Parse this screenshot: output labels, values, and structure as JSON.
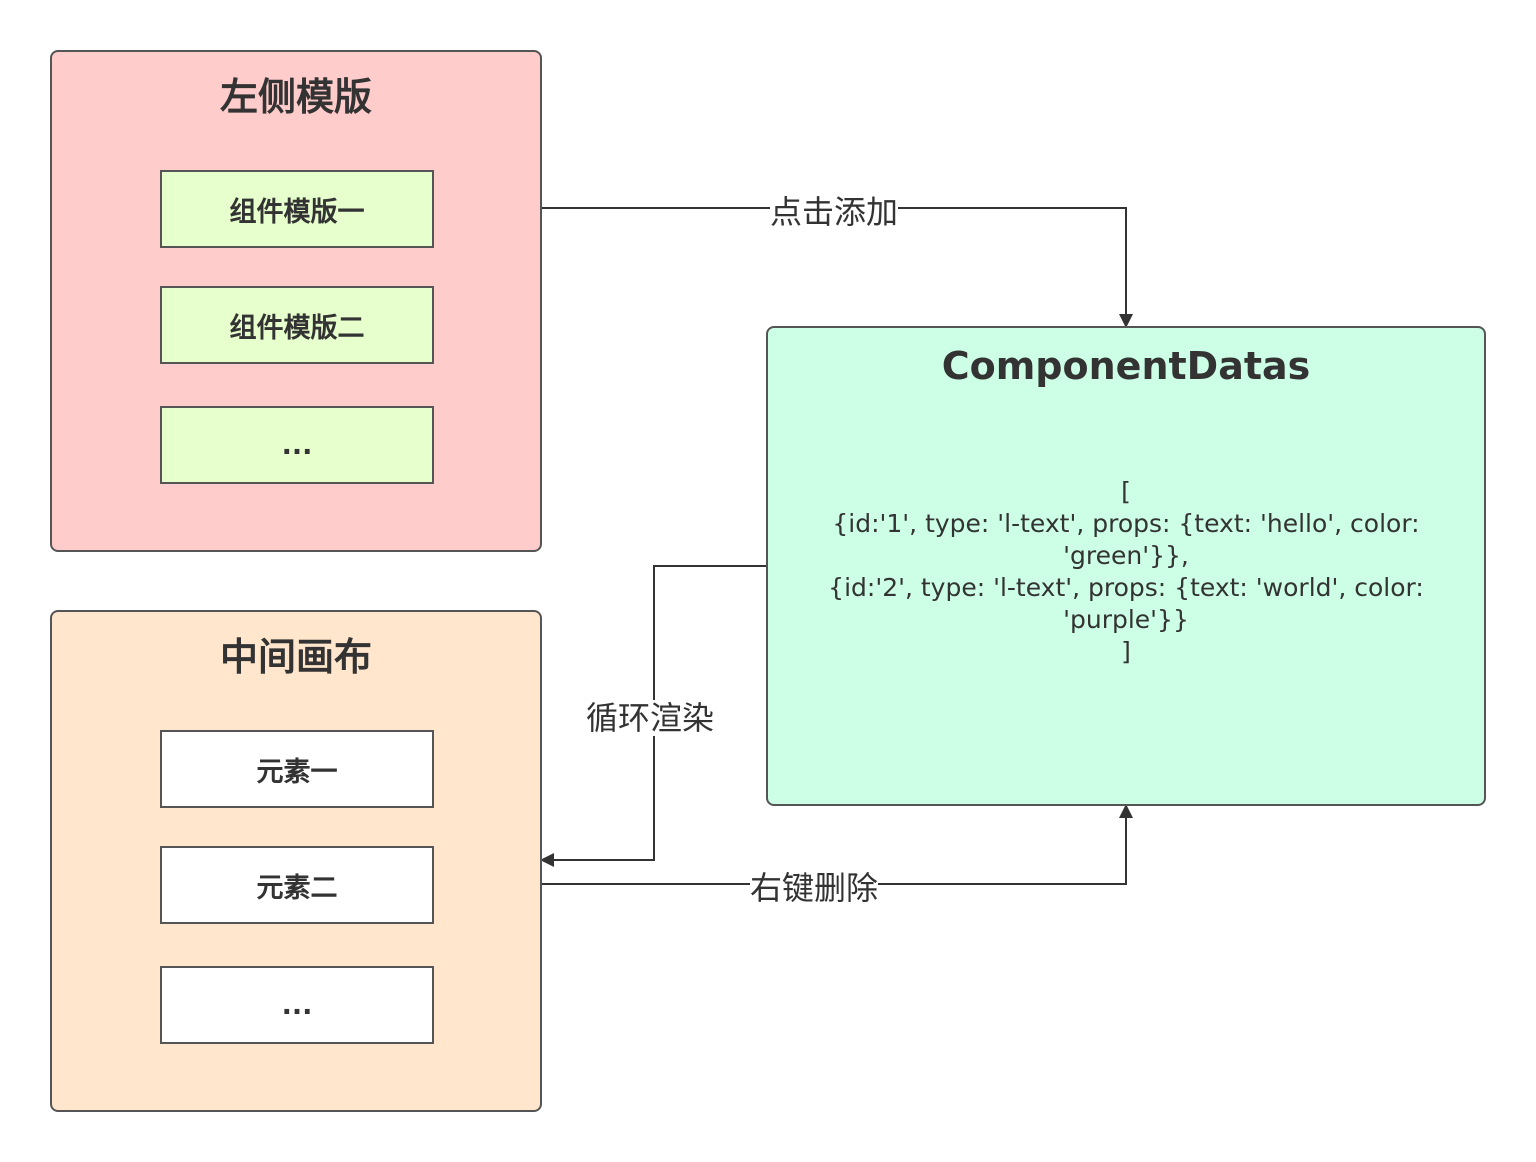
{
  "left_templates": {
    "title": "左侧模版",
    "items": [
      "组件模版一",
      "组件模版二",
      "..."
    ],
    "fill": "#ffcccc",
    "item_fill": "#e6ffcc"
  },
  "canvas": {
    "title": "中间画布",
    "items": [
      "元素一",
      "元素二",
      "..."
    ],
    "fill": "#ffe6cc",
    "item_fill": "#ffffff"
  },
  "component_datas": {
    "title": "ComponentDatas",
    "content": "[\n{id:'1', type: 'l-text', props: {text: 'hello', color: 'green'}},\n{id:'2', type: 'l-text', props: {text: 'world', color: 'purple'}}\n]",
    "fill": "#ccffe6"
  },
  "edges": {
    "add": "点击添加",
    "render": "循环渲染",
    "delete": "右键删除"
  },
  "colors": {
    "stroke": "#333333",
    "border": "#555555"
  }
}
